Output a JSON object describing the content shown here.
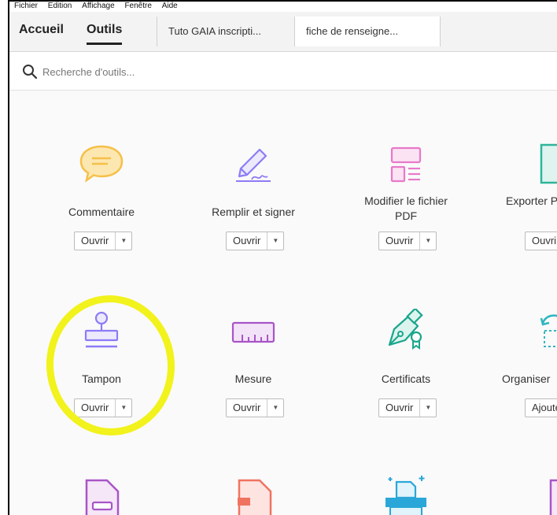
{
  "menu": [
    "Fichier",
    "Edition",
    "Affichage",
    "Fenêtre",
    "Aide"
  ],
  "nav": {
    "home": "Accueil",
    "tools": "Outils"
  },
  "doc_tabs": [
    "Tuto GAIA inscripti...",
    "fiche de renseigne..."
  ],
  "search": {
    "placeholder": "Recherche d'outils..."
  },
  "tools": [
    {
      "label": "Commentaire",
      "icon": "comment-icon",
      "button": "Ouvrir"
    },
    {
      "label": "Remplir et signer",
      "icon": "fill-sign-icon",
      "button": "Ouvrir"
    },
    {
      "label": "Modifier le fichier PDF",
      "icon": "edit-pdf-icon",
      "button": "Ouvrir"
    },
    {
      "label": "Exporter PD",
      "icon": "export-pdf-icon",
      "button": "Ouvri"
    },
    {
      "label": "Tampon",
      "icon": "stamp-icon",
      "button": "Ouvrir"
    },
    {
      "label": "Mesure",
      "icon": "ruler-icon",
      "button": "Ouvrir"
    },
    {
      "label": "Certificats",
      "icon": "certificate-icon",
      "button": "Ouvrir"
    },
    {
      "label": "Organiser",
      "icon": "organize-icon",
      "button": "Ajoute"
    }
  ],
  "colors": {
    "accent_highlight": "#f2f21c",
    "comment": "#f9c74f",
    "fill_sign": "#8b7cf6",
    "edit_pdf": "#e879c9",
    "export": "#2fb59a",
    "stamp": "#8b7cf6",
    "ruler": "#a855c7",
    "cert": "#1aa58c"
  }
}
